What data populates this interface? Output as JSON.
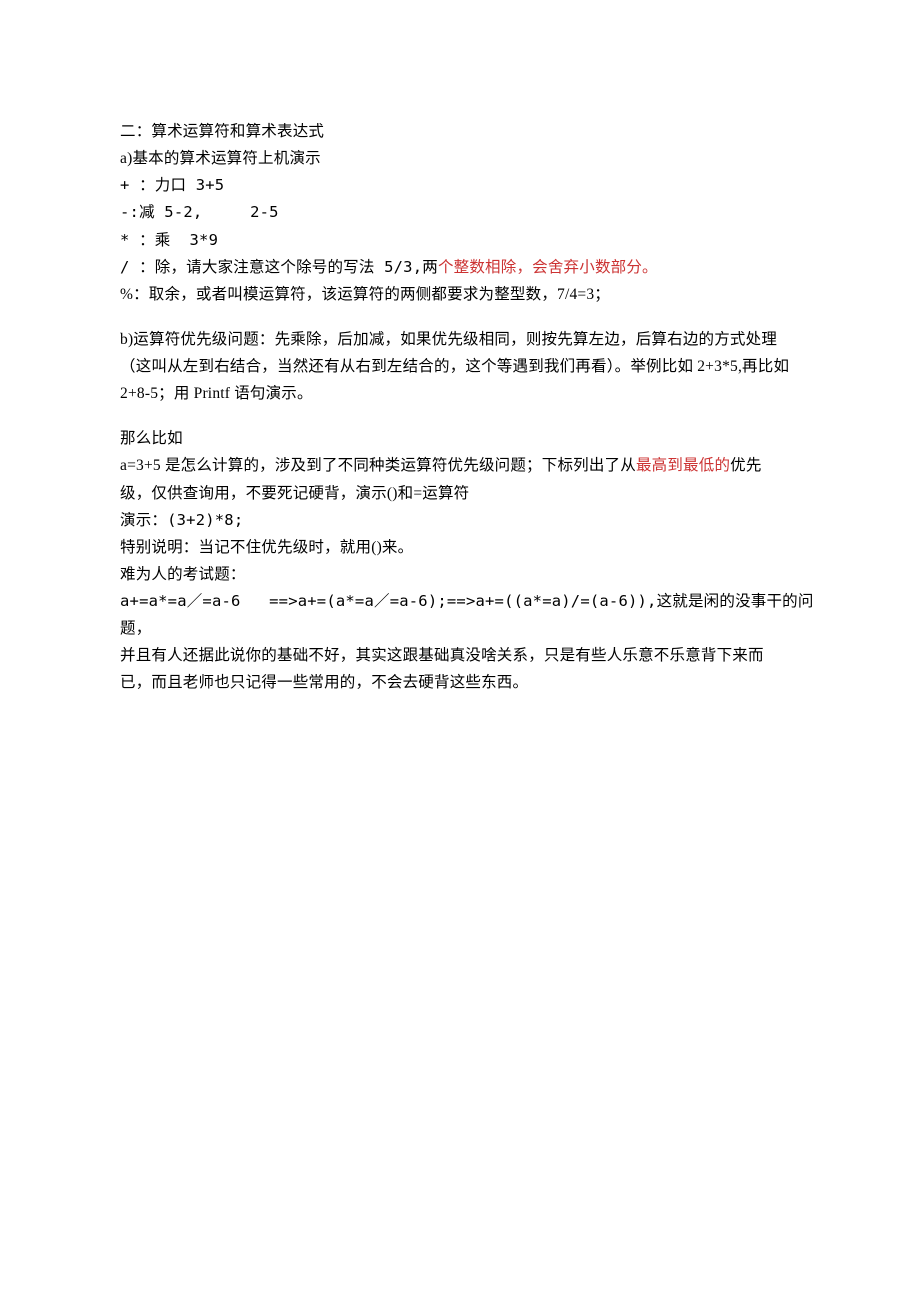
{
  "doc": {
    "l1": "二：算术运算符和算术表达式",
    "l2": "a)基本的算术运算符上机演示",
    "l3": "+ ：力口 3+5",
    "l4": "-:减 5-2,     2-5",
    "l5": "* ：乘  3*9",
    "l6a": "/ ：除，请大家注意这个除号的写法 5/3,两",
    "l6b": "个整数相除，会舍弃小数部分。",
    "l7": "%：取余，或者叫模运算符，该运算符的两侧都要求为整型数，7/4=3；",
    "l8": "b)运算符优先级问题：先乘除，后加减，如果优先级相同，则按先算左边，后算右边的方式处理",
    "l9": "（这叫从左到右结合，当然还有从右到左结合的，这个等遇到我们再看）。举例比如 2+3*5,再比如",
    "l10": "2+8-5；用 Printf 语句演示。",
    "l11": "那么比如",
    "l12a": "a=3+5 是怎么计算的，涉及到了不同种类运算符优先级问题；下标列出了从",
    "l12b": "最高到最低的",
    "l12c": "优先",
    "l13": "级，仅供查询用，不要死记硬背，演示()和=运算符",
    "l14": "演示：(3+2)*8;",
    "l15": "特别说明：当记不住优先级时，就用()来。",
    "l16": "难为人的考试题：",
    "l17": "a+=a*=a／=a-6   ==>a+=(a*=a／=a-6);==>a+=((a*=a)/=(a-6)),这就是闲的没事干的问题，",
    "l18": "并且有人还据此说你的基础不好，其实这跟基础真没啥关系，只是有些人乐意不乐意背下来而",
    "l19": "已，而且老师也只记得一些常用的，不会去硬背这些东西。"
  }
}
